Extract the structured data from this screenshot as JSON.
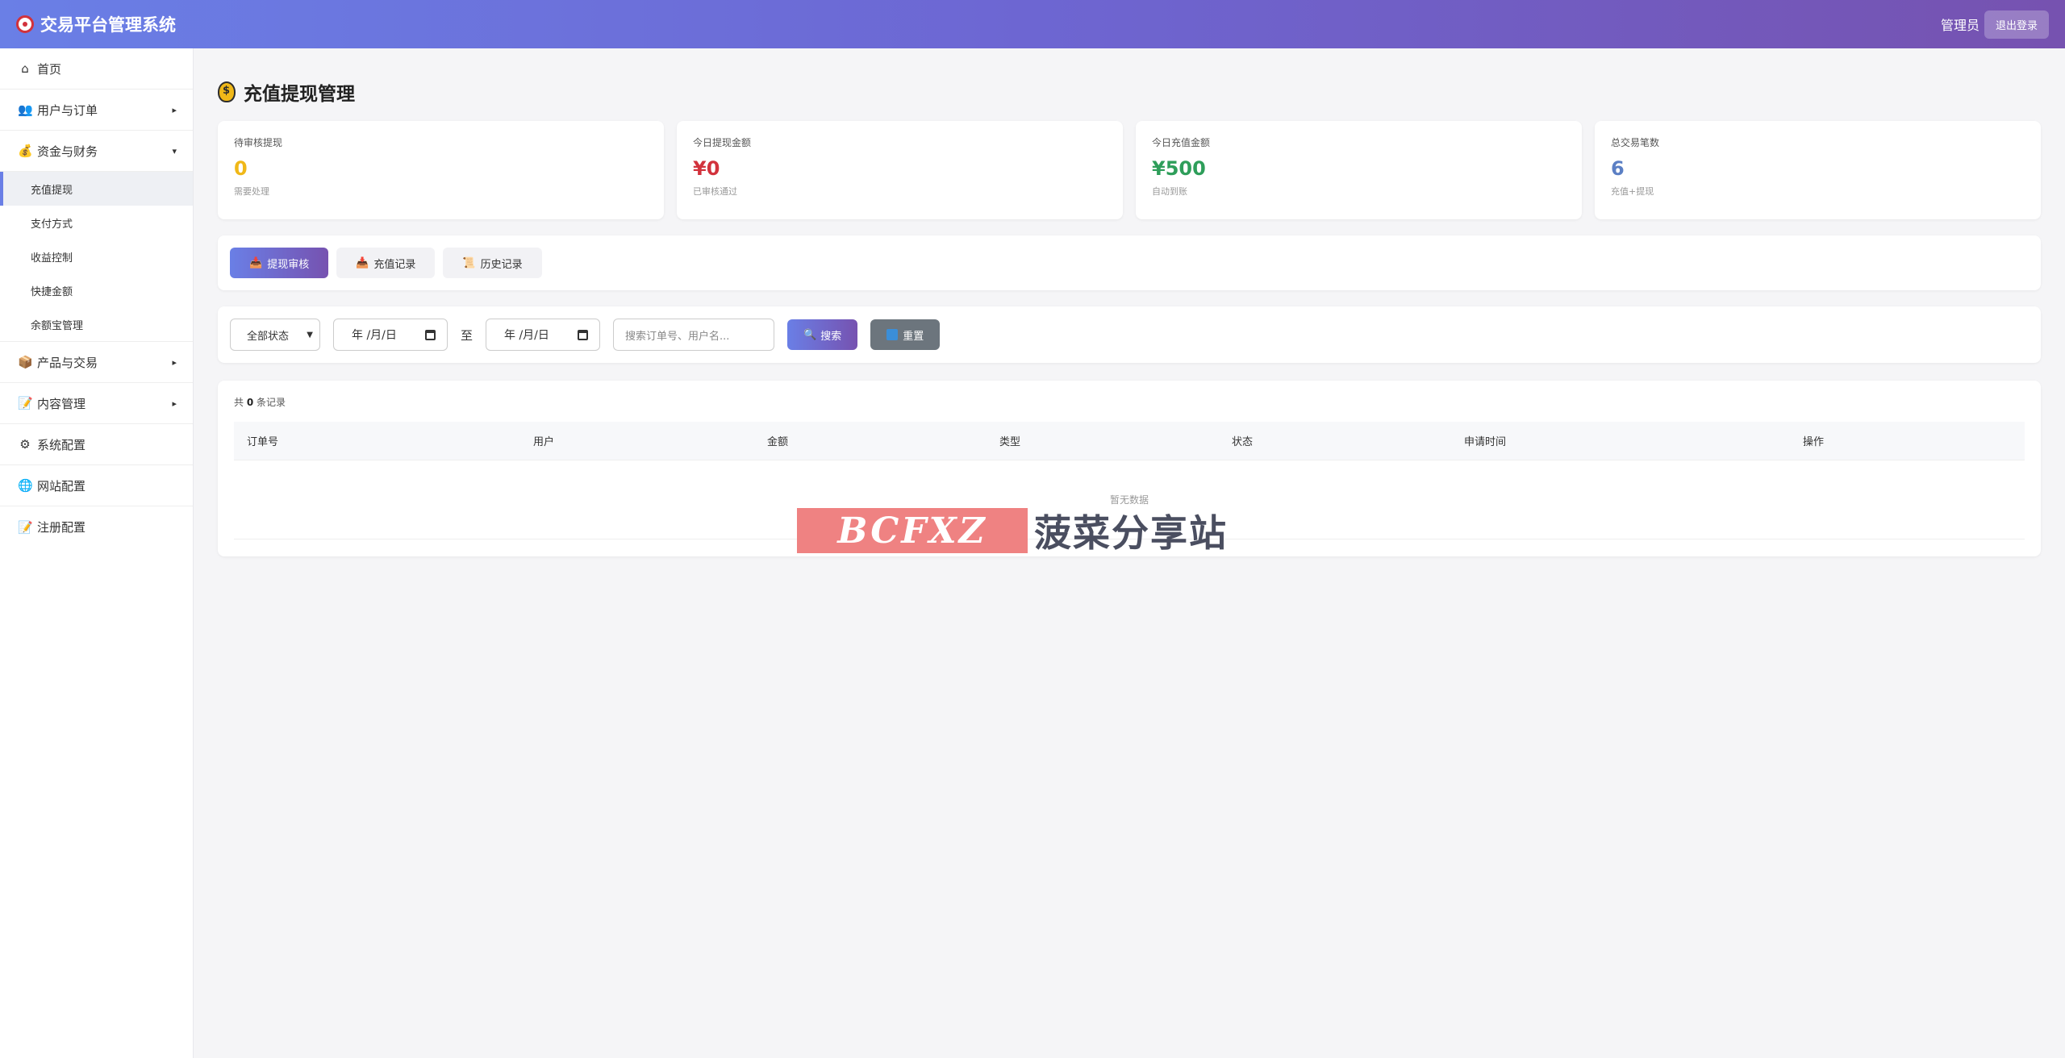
{
  "header": {
    "title": "交易平台管理系统",
    "user_label": "管理员",
    "logout_label": "退出登录"
  },
  "sidebar": {
    "items": [
      {
        "label": "首页",
        "icon": "home-icon"
      },
      {
        "label": "用户与订单",
        "icon": "users-icon",
        "arrow": "▸"
      },
      {
        "label": "资金与财务",
        "icon": "money-bag-icon",
        "arrow": "▾"
      },
      {
        "label": "产品与交易",
        "icon": "package-icon",
        "arrow": "▸"
      },
      {
        "label": "内容管理",
        "icon": "memo-icon",
        "arrow": "▸"
      },
      {
        "label": "系统配置",
        "icon": "gear-icon"
      },
      {
        "label": "网站配置",
        "icon": "globe-icon"
      },
      {
        "label": "注册配置",
        "icon": "memo-icon"
      }
    ],
    "sub_items": [
      "充值提现",
      "支付方式",
      "收益控制",
      "快捷金额",
      "余额宝管理"
    ]
  },
  "page": {
    "title": "充值提现管理"
  },
  "stats": [
    {
      "label": "待审核提现",
      "value": "0",
      "note": "需要处理",
      "color": "#f0b818"
    },
    {
      "label": "今日提现金额",
      "value": "¥0",
      "note": "已审核通过",
      "color": "#d2323c"
    },
    {
      "label": "今日充值金额",
      "value": "¥500",
      "note": "自动到账",
      "color": "#2e9e5a"
    },
    {
      "label": "总交易笔数",
      "value": "6",
      "note": "充值+提现",
      "color": "#5b7fc4"
    }
  ],
  "tabs": [
    {
      "label": "提现审核",
      "active": true
    },
    {
      "label": "充值记录",
      "active": false
    },
    {
      "label": "历史记录",
      "active": false
    }
  ],
  "filters": {
    "status_select": "全部状态",
    "date_start": "年 /月/日",
    "to_label": "至",
    "date_end": "年 /月/日",
    "search_placeholder": "搜索订单号、用户名...",
    "search_button": "搜索",
    "reset_button": "重置"
  },
  "table": {
    "count_prefix": "共",
    "count": "0",
    "count_suffix": "条记录",
    "columns": [
      "订单号",
      "用户",
      "金额",
      "类型",
      "状态",
      "申请时间",
      "操作"
    ],
    "empty_text": "暂无数据"
  },
  "watermark": {
    "logo_text": "BCFXZ",
    "site_name": "菠菜分享站"
  }
}
